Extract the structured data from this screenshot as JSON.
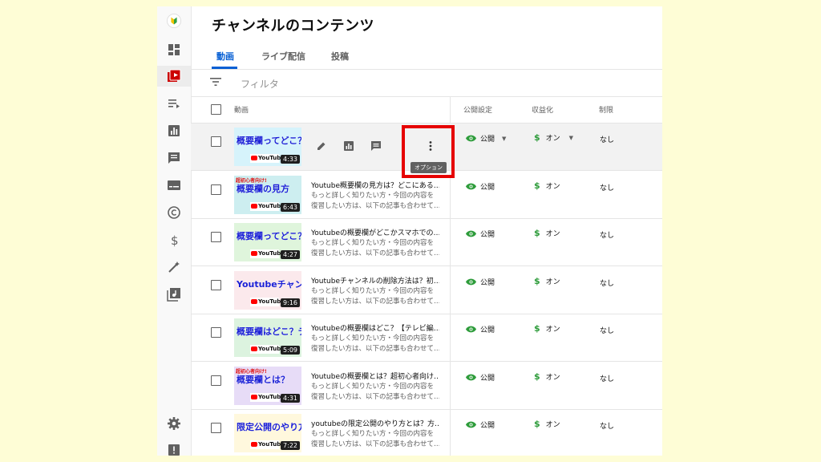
{
  "page": {
    "title": "チャンネルのコンテンツ"
  },
  "tabs": [
    {
      "label": "動画",
      "active": true
    },
    {
      "label": "ライブ配信",
      "active": false
    },
    {
      "label": "投稿",
      "active": false
    }
  ],
  "filter": {
    "placeholder": "フィルタ"
  },
  "table": {
    "headers": {
      "video": "動画",
      "visibility": "公開設定",
      "monetization": "収益化",
      "restrictions": "制限"
    }
  },
  "tooltip": "オプション",
  "rows": [
    {
      "thumb_text": "概要欄ってどこ？",
      "thumb_tag": "",
      "yt": "YouTube",
      "duration": "4:33",
      "title": "",
      "desc1": "",
      "desc2": "",
      "visibility": "公開",
      "monetization": "オン",
      "restrictions": "なし",
      "hover": true
    },
    {
      "thumb_text": "概要欄の見方",
      "thumb_tag": "超初心者向け!",
      "yt": "YouTube",
      "duration": "6:43",
      "title": "Youtube概要欄の見方は？どこにある…",
      "desc1": "もっと詳しく知りたい方・今回の内容を",
      "desc2": "復習したい方は、以下の記事も合わせて…",
      "visibility": "公開",
      "monetization": "オン",
      "restrictions": "なし",
      "hover": false
    },
    {
      "thumb_text": "概要欄ってどこ？",
      "thumb_tag": "",
      "yt": "YouTube",
      "duration": "4:27",
      "title": "Youtubeの概要欄がどこかスマホでの…",
      "desc1": "もっと詳しく知りたい方・今回の内容を",
      "desc2": "復習したい方は、以下の記事も合わせて…",
      "visibility": "公開",
      "monetization": "オン",
      "restrictions": "なし",
      "hover": false
    },
    {
      "thumb_text": "Youtubeチャンネルの削除方法",
      "thumb_tag": "",
      "yt": "YouTube",
      "duration": "9:16",
      "title": "Youtubeチャンネルの削除方法は？初…",
      "desc1": "もっと詳しく知りたい方・今回の内容を",
      "desc2": "復習したい方は、以下の記事も合わせて…",
      "visibility": "公開",
      "monetization": "オン",
      "restrictions": "なし",
      "hover": false
    },
    {
      "thumb_text": "概要欄はどこ？テレビ編",
      "thumb_tag": "",
      "yt": "YouTube",
      "duration": "5:09",
      "title": "Youtubeの概要欄はどこ？【テレビ編…",
      "desc1": "もっと詳しく知りたい方・今回の内容を",
      "desc2": "復習したい方は、以下の記事も合わせて…",
      "visibility": "公開",
      "monetization": "オン",
      "restrictions": "なし",
      "hover": false
    },
    {
      "thumb_text": "概要欄とは？",
      "thumb_tag": "超初心者向け!",
      "yt": "YouTube",
      "duration": "4:31",
      "title": "Youtubeの概要欄とは？超初心者向け…",
      "desc1": "もっと詳しく知りたい方・今回の内容を",
      "desc2": "復習したい方は、以下の記事も合わせて…",
      "visibility": "公開",
      "monetization": "オン",
      "restrictions": "なし",
      "hover": false
    },
    {
      "thumb_text": "限定公開のやり方",
      "thumb_tag": "",
      "yt": "YouTube",
      "duration": "7:22",
      "title": "youtubeの限定公開のやり方とは？方…",
      "desc1": "もっと詳しく知りたい方・今回の内容を",
      "desc2": "復習したい方は、以下の記事も合わせて…",
      "visibility": "公開",
      "monetization": "オン",
      "restrictions": "なし",
      "hover": false
    }
  ],
  "nav_icons": [
    "logo-icon",
    "dashboard-icon",
    "content-icon",
    "playlists-icon",
    "analytics-icon",
    "comments-icon",
    "subtitles-icon",
    "copyright-icon",
    "earn-icon",
    "customization-icon",
    "audio-library-icon",
    "settings-icon",
    "feedback-icon"
  ]
}
